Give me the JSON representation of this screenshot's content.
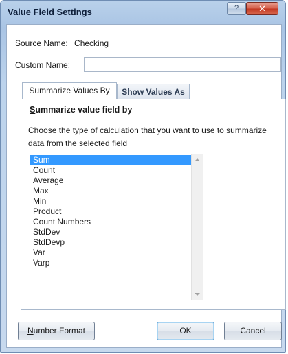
{
  "window": {
    "title": "Value Field Settings",
    "help_glyph": "?",
    "close_glyph": "✕"
  },
  "source": {
    "label": "Source Name:",
    "value": "Checking"
  },
  "custom_name": {
    "label_underlined": "C",
    "label_rest": "ustom Name:",
    "value": ""
  },
  "tabs": [
    {
      "label": "Summarize Values By",
      "active": true
    },
    {
      "label": "Show Values As",
      "active": false
    }
  ],
  "summarize": {
    "title_underlined": "S",
    "title_rest": "ummarize value field by",
    "description": "Choose the type of calculation that you want to use to summarize data from the selected field",
    "options": [
      "Sum",
      "Count",
      "Average",
      "Max",
      "Min",
      "Product",
      "Count Numbers",
      "StdDev",
      "StdDevp",
      "Var",
      "Varp"
    ],
    "selected": "Sum"
  },
  "buttons": {
    "number_format_underlined": "N",
    "number_format_rest": "umber Format",
    "ok": "OK",
    "cancel": "Cancel"
  },
  "colors": {
    "selection": "#3399ff",
    "close_button": "#c33a24",
    "frame": "#a9c4e4"
  }
}
